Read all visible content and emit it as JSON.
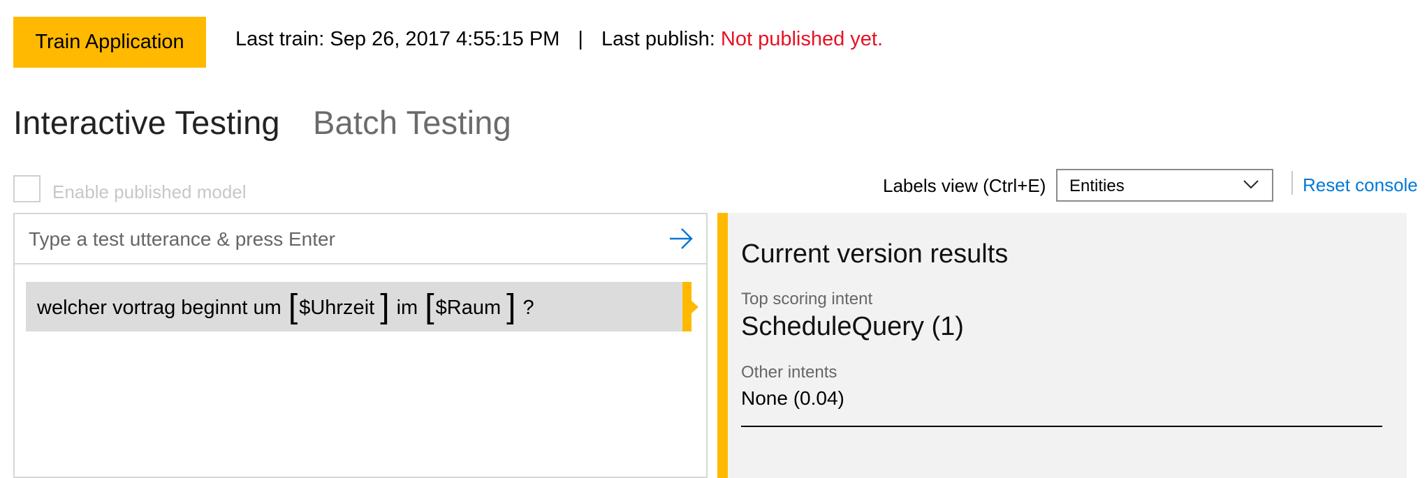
{
  "header": {
    "train_button": "Train Application",
    "last_train_label": "Last train:",
    "last_train_value": "Sep 26, 2017 4:55:15 PM",
    "separator": "|",
    "last_publish_label": "Last publish:",
    "last_publish_value": "Not published yet."
  },
  "tabs": [
    {
      "label": "Interactive Testing",
      "active": true
    },
    {
      "label": "Batch Testing",
      "active": false
    }
  ],
  "controls": {
    "enable_published_model_label": "Enable published model",
    "enable_published_model_checked": false,
    "labels_view_label": "Labels view (Ctrl+E)",
    "labels_view_selected": "Entities",
    "reset_console": "Reset console"
  },
  "test_panel": {
    "input_placeholder": "Type a test utterance & press Enter",
    "input_value": "",
    "utterance": {
      "part1": "welcher vortrag beginnt um",
      "entity1": "$Uhrzeit",
      "part2": "im",
      "entity2": "$Raum",
      "part3": "?"
    }
  },
  "results": {
    "title": "Current version results",
    "top_intent_label": "Top scoring intent",
    "top_intent_value": "ScheduleQuery (1)",
    "other_intents_label": "Other intents",
    "other_intents_value": "None (0.04)"
  },
  "colors": {
    "accent": "#ffb900",
    "link": "#0078d7",
    "error": "#e81123"
  },
  "icons": {
    "send": "arrow-right-icon",
    "dropdown": "chevron-down-icon"
  }
}
